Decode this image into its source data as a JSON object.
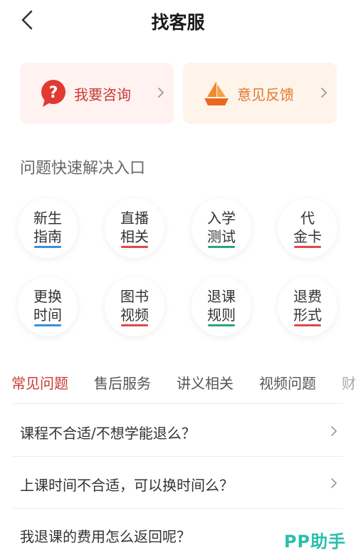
{
  "header": {
    "title": "找客服"
  },
  "cards": [
    {
      "label": "我要咨询",
      "icon": "question-bubble-icon"
    },
    {
      "label": "意见反馈",
      "icon": "paper-boat-icon"
    }
  ],
  "quick": {
    "title": "问题快速解决入口",
    "items": [
      {
        "line1": "新生",
        "line2": "指南",
        "underline": "#3a8fd9"
      },
      {
        "line1": "直播",
        "line2": "相关",
        "underline": "#e04848"
      },
      {
        "line1": "入学",
        "line2": "测试",
        "underline": "#2aa57a"
      },
      {
        "line1": "代",
        "line2": "金卡",
        "underline": "#e04848"
      },
      {
        "line1": "更换",
        "line2": "时间",
        "underline": "#3a8fd9"
      },
      {
        "line1": "图书",
        "line2": "视频",
        "underline": "#e04848"
      },
      {
        "line1": "退课",
        "line2": "规则",
        "underline": "#2aa57a"
      },
      {
        "line1": "退费",
        "line2": "形式",
        "underline": "#e04848"
      }
    ]
  },
  "tabs": [
    "常见问题",
    "售后服务",
    "讲义相关",
    "视频问题",
    "财"
  ],
  "active_tab": "常见问题",
  "questions": [
    "课程不合适/不想学能退么？",
    "上课时间不合适，可以换时间么？",
    "我退课的费用怎么返回呢？"
  ],
  "watermark": "PP助手",
  "colors": {
    "accent": "#c93a32",
    "feedback": "#e0772e",
    "consult_bg": "#fff2f1",
    "feedback_bg": "#fff4ea"
  }
}
